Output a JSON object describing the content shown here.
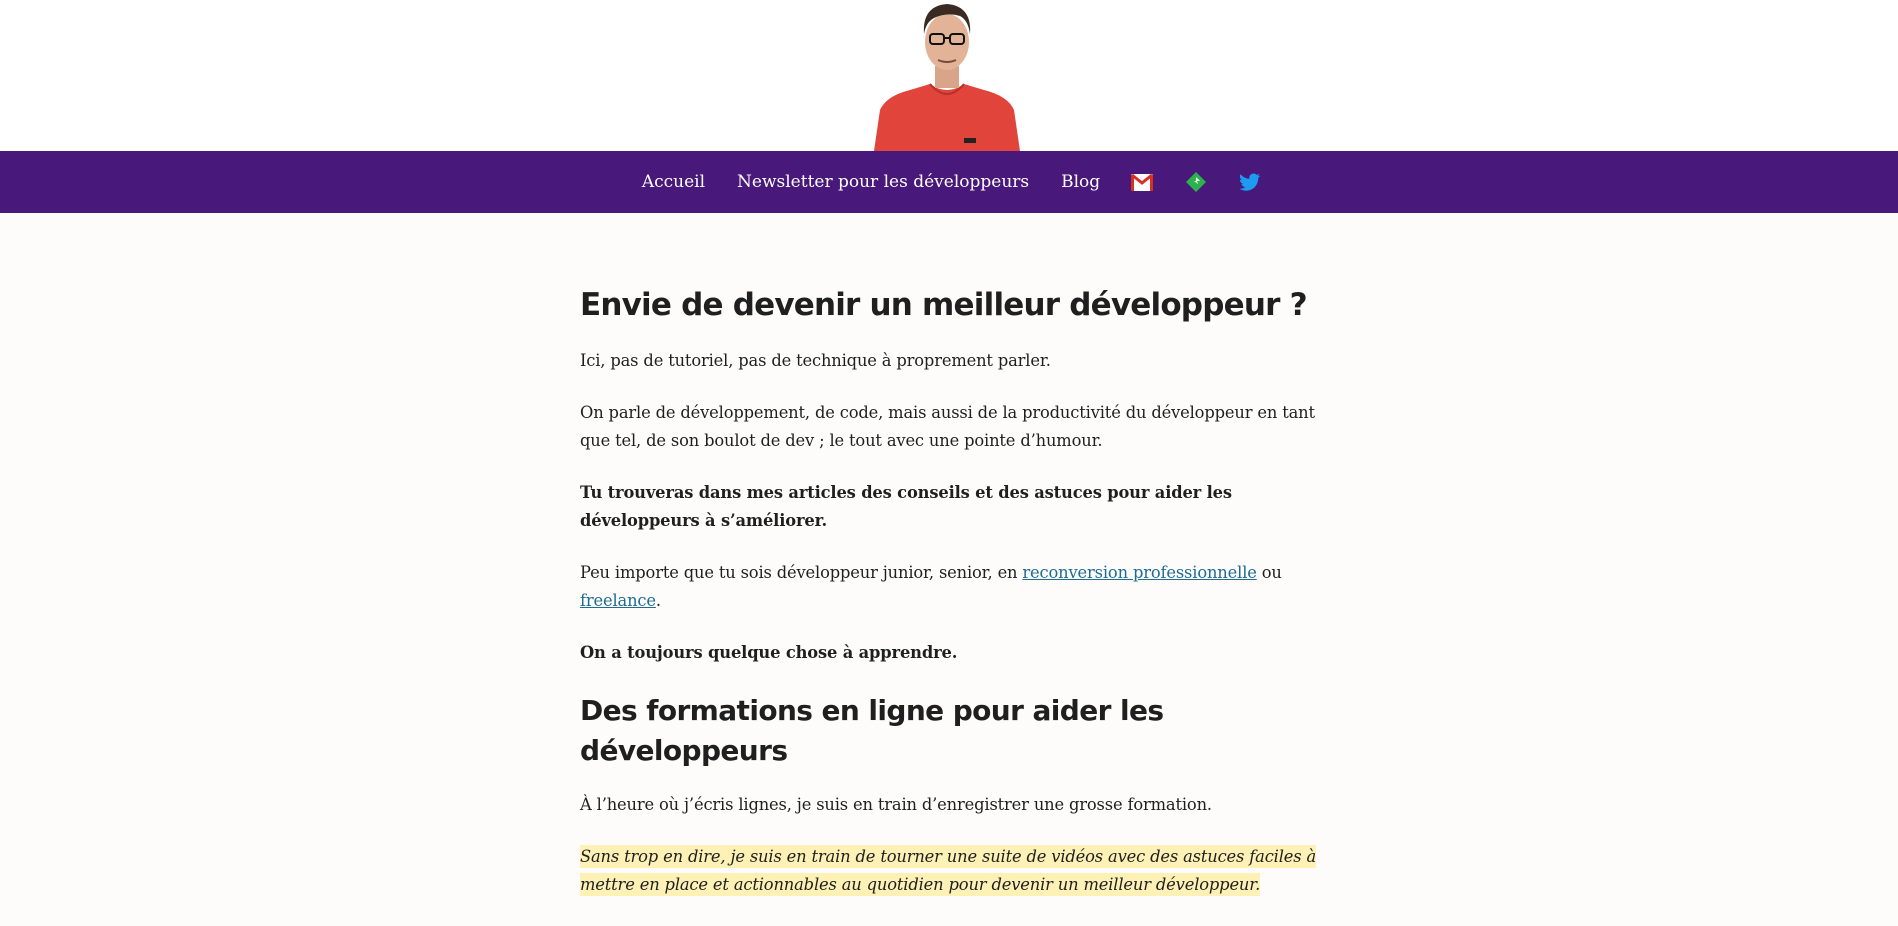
{
  "nav": {
    "items": [
      "Accueil",
      "Newsletter pour les développeurs",
      "Blog"
    ],
    "icons": [
      "gmail-icon",
      "feedly-icon",
      "twitter-icon"
    ]
  },
  "main": {
    "heading1": "Envie de devenir un meilleur développeur ?",
    "p1": "Ici, pas de tutoriel, pas de technique à proprement parler.",
    "p2": "On parle de développement, de code, mais aussi de la productivité du développeur en tant que tel, de son boulot de dev ; le tout avec une pointe d’humour.",
    "p3": "Tu trouveras dans mes articles des conseils et des astuces pour aider les développeurs à s’améliorer.",
    "p4_before": "Peu importe que tu sois développeur junior, senior, en ",
    "p4_link1": "reconversion professionnelle",
    "p4_middle": " ou ",
    "p4_link2": "freelance",
    "p4_after": ".",
    "p5": "On a toujours quelque chose à apprendre.",
    "heading2": "Des formations en ligne pour aider les développeurs",
    "p6": "À l’heure où j’écris lignes, je suis en train d’enregistrer une grosse formation.",
    "p7": " Sans trop en dire, je suis en train de tourner une suite de vidéos avec des astuces faciles à mettre en place et actionnables au quotidien pour devenir un meilleur développeur. "
  },
  "colors": {
    "nav_background": "#48187a",
    "link": "#1e6b93",
    "highlight": "#fdf1b6"
  }
}
